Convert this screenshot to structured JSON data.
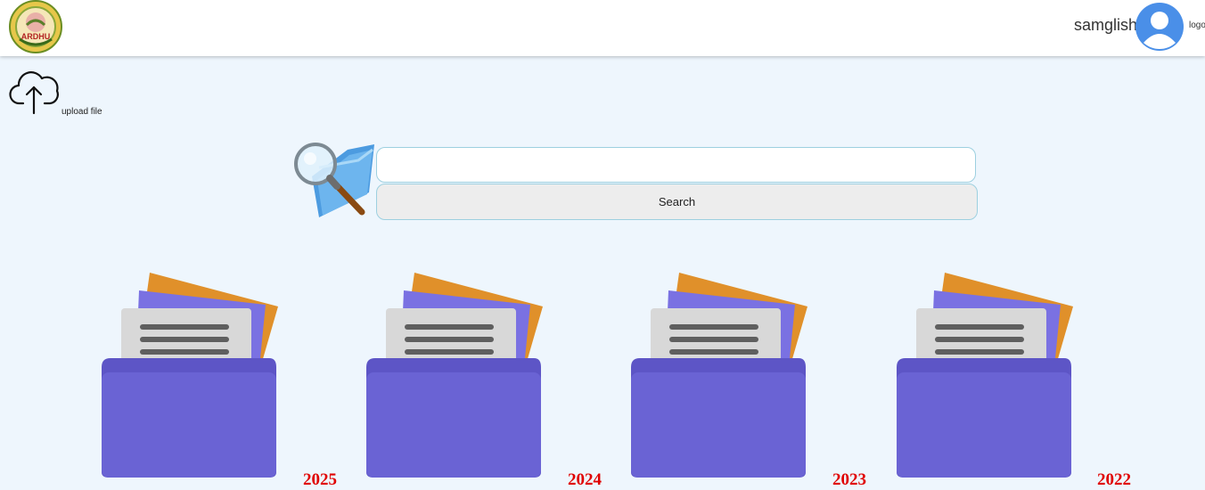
{
  "header": {
    "logo_text": "ARDHU",
    "username": "samglish",
    "logout_label": "logout"
  },
  "upload": {
    "label": "upload file"
  },
  "search": {
    "value": "",
    "placeholder": "",
    "button_label": "Search"
  },
  "folders": [
    {
      "year": "2025"
    },
    {
      "year": "2024"
    },
    {
      "year": "2023"
    },
    {
      "year": "2022"
    }
  ],
  "colors": {
    "background": "#eef6fd",
    "year_text": "#e00000",
    "folder_body": "#6a63d4",
    "folder_back": "#8079e6",
    "folder_paper_orange": "#e0902a",
    "avatar": "#4a8fe8"
  }
}
